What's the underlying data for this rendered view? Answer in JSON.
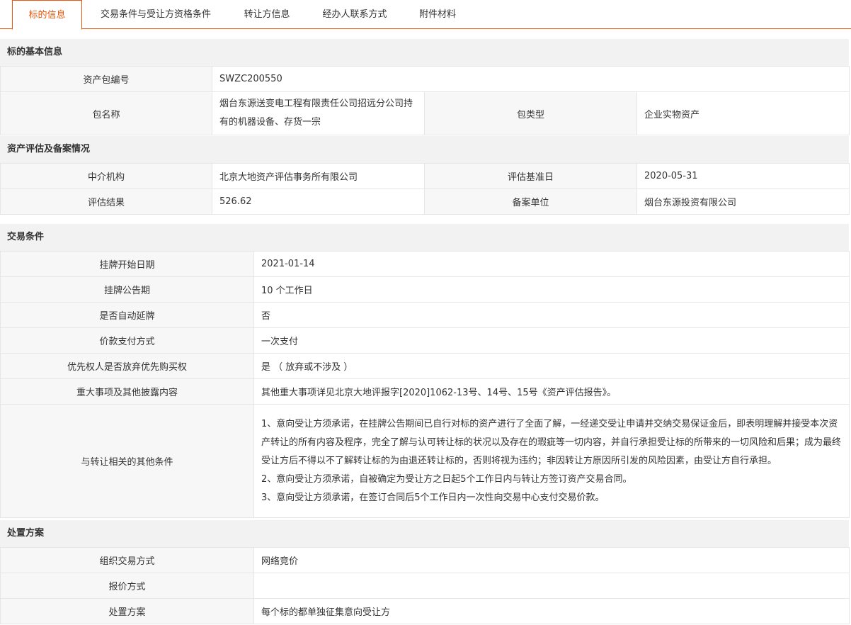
{
  "tabs": [
    {
      "label": "标的信息",
      "active": true
    },
    {
      "label": "交易条件与受让方资格条件",
      "active": false
    },
    {
      "label": "转让方信息",
      "active": false
    },
    {
      "label": "经办人联系方式",
      "active": false
    },
    {
      "label": "附件材料",
      "active": false
    }
  ],
  "basic": {
    "title": "标的基本信息",
    "asset_no_label": "资产包编号",
    "asset_no_value": "SWZC200550",
    "name_label": "包名称",
    "name_value": "烟台东源送变电工程有限责任公司招远分公司持有的机器设备、存货一宗",
    "type_label": "包类型",
    "type_value": "企业实物资产"
  },
  "eval": {
    "title": "资产评估及备案情况",
    "agency_label": "中介机构",
    "agency_value": "北京大地资产评估事务所有限公司",
    "base_date_label": "评估基准日",
    "base_date_value": "2020-05-31",
    "result_label": "评估结果",
    "result_value": "526.62",
    "filing_label": "备案单位",
    "filing_value": "烟台东源投资有限公司"
  },
  "trade": {
    "title": "交易条件",
    "rows": [
      {
        "label": "挂牌开始日期",
        "value": "2021-01-14"
      },
      {
        "label": "挂牌公告期",
        "value": "10 个工作日"
      },
      {
        "label": "是否自动延牌",
        "value": "否"
      },
      {
        "label": "价款支付方式",
        "value": "一次支付"
      },
      {
        "label": "优先权人是否放弃优先购买权",
        "value": "是 （ 放弃或不涉及 ）"
      },
      {
        "label": "重大事项及其他披露内容",
        "value": "其他重大事项详见北京大地评报字[2020]1062-13号、14号、15号《资产评估报告》。"
      }
    ],
    "other_label": "与转让相关的其他条件",
    "other_lines": [
      "1、意向受让方须承诺，在挂牌公告期间已自行对标的资产进行了全面了解，一经递交受让申请并交纳交易保证金后，即表明理解并接受本次资产转让的所有内容及程序，完全了解与认可转让标的状况以及存在的瑕疵等一切内容，并自行承担受让标的所带来的一切风险和后果；成为最终受让方后不得以不了解转让标的为由退还转让标的，否则将视为违约；非因转让方原因所引发的风险因素，由受让方自行承担。",
      "2、意向受让方须承诺，自被确定为受让方之日起5个工作日内与转让方签订资产交易合同。",
      "3、意向受让方须承诺，在签订合同后5个工作日内一次性向交易中心支付交易价款。"
    ]
  },
  "disposal": {
    "title": "处置方案",
    "rows": [
      {
        "label": "组织交易方式",
        "value": "网络竞价"
      },
      {
        "label": "报价方式",
        "value": ""
      },
      {
        "label": "处置方案",
        "value": "每个标的都单独征集意向受让方"
      }
    ]
  }
}
